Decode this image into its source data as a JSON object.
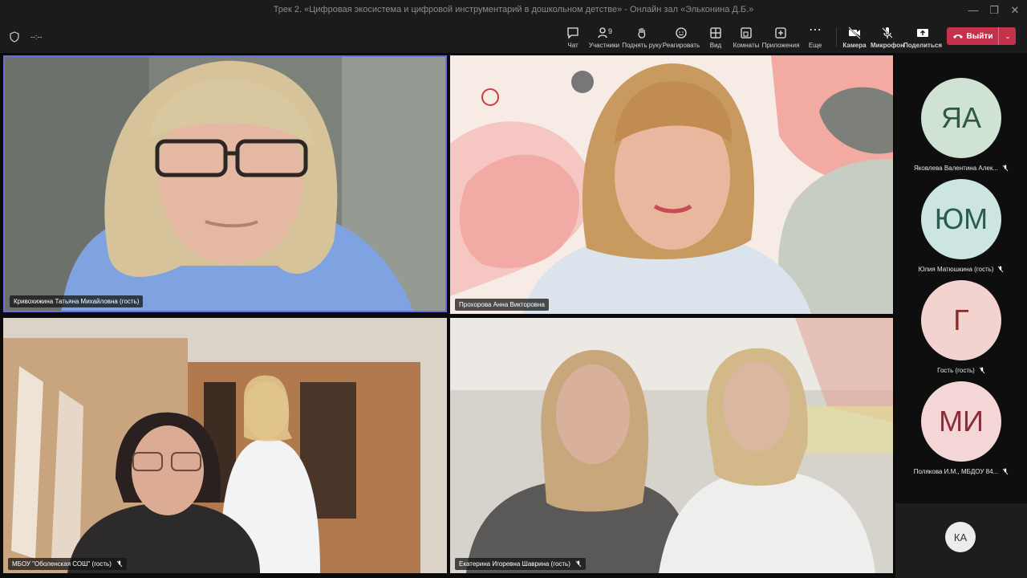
{
  "window": {
    "title": "Трек 2. «Цифровая экосистема и цифровой инструментарий в дошкольном детстве» - Онлайн зал «Эльконина Д.Б.»",
    "timer": "--:--"
  },
  "toolbar": {
    "chat": "Чат",
    "participants": "Участники",
    "participants_count": "9",
    "raise_hand": "Поднять руку",
    "react": "Реагировать",
    "view": "Вид",
    "rooms": "Комнаты",
    "apps": "Приложения",
    "more": "Еще",
    "camera": "Камера",
    "mic": "Микрофон",
    "share": "Поделиться",
    "leave": "Выйти"
  },
  "tiles": [
    {
      "name": "Кривохижина Татьяна Михайловна (гость)"
    },
    {
      "name": "Прохорова Анна Викторовна"
    },
    {
      "name": "МБОУ \"Оболенская СОШ\" (гость)"
    },
    {
      "name": "Екатерина Игоревна Шаврина (гость)"
    }
  ],
  "sidebar": {
    "participants": [
      {
        "initials": "ЯА",
        "name": "Яковлева Валентина Алек...",
        "color": "#cfe2d4"
      },
      {
        "initials": "ЮМ",
        "name": "Юлия Матюшкина (гость)",
        "color": "#cde5e0"
      },
      {
        "initials": "Г",
        "name": "Гость (гость)",
        "color": "#f3d3d0"
      },
      {
        "initials": "МИ",
        "name": "Полякова И.М., МБДОУ 84...",
        "color": "#f5d6d6"
      }
    ],
    "overflow_initials": "КА"
  },
  "colors": {
    "background": "#0b0b0b",
    "toolbar": "#1b1b1b",
    "leave": "#c4314b",
    "active_border": "#6b6fd9"
  }
}
